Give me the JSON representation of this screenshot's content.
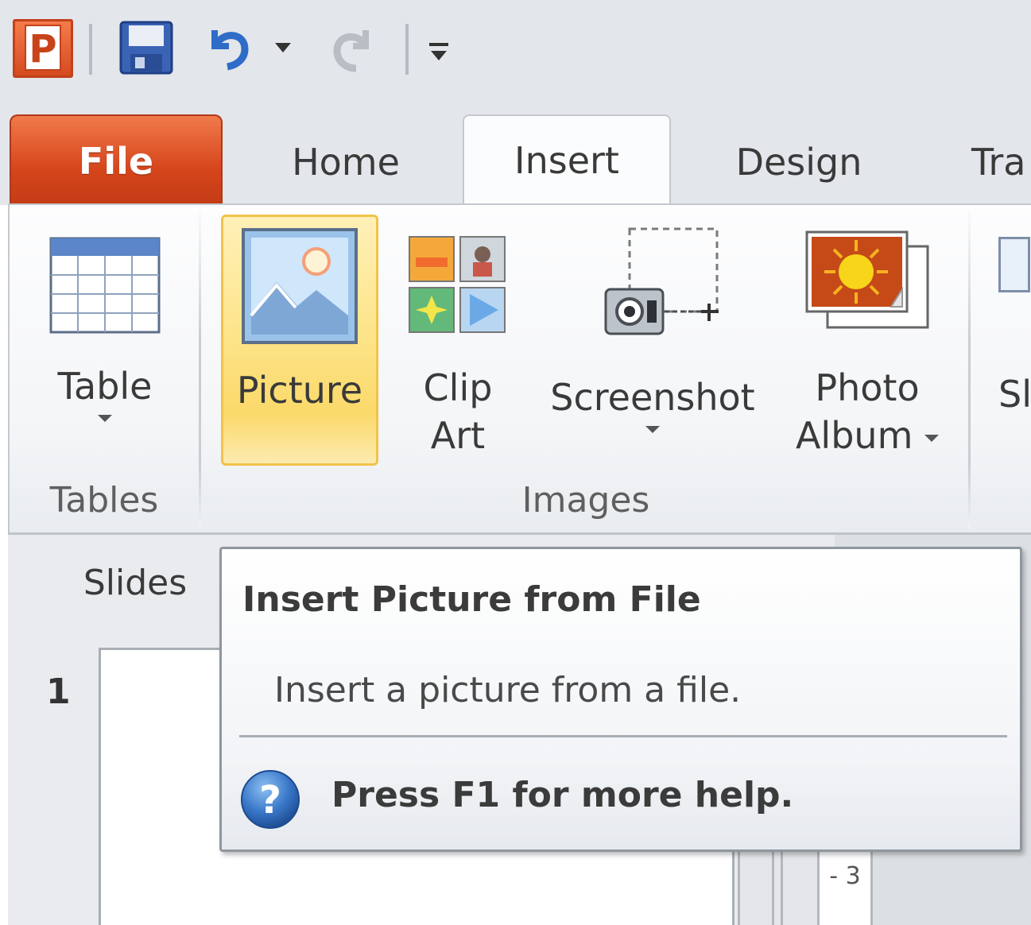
{
  "quick_access": {
    "app_letter": "P",
    "icons": [
      "powerpoint-logo-icon",
      "save-icon",
      "undo-icon",
      "undo-dropdown-icon",
      "redo-icon",
      "customize-toolbar-icon"
    ]
  },
  "tabs": [
    {
      "label": "File"
    },
    {
      "label": "Home"
    },
    {
      "label": "Insert"
    },
    {
      "label": "Design"
    },
    {
      "label": "Tra"
    }
  ],
  "ribbon": {
    "groups": {
      "tables": {
        "label": "Tables"
      },
      "images": {
        "label": "Images"
      }
    },
    "buttons": {
      "table": {
        "label": "Table"
      },
      "picture": {
        "label": "Picture"
      },
      "clip_art": {
        "line1": "Clip",
        "line2": "Art"
      },
      "screenshot": {
        "label": "Screenshot"
      },
      "photo_album": {
        "line1": "Photo",
        "line2": "Album"
      },
      "next_partial": {
        "label": "Sl"
      }
    }
  },
  "slides_panel": {
    "tab_label": "Slides",
    "slide_number": "1",
    "ruler_marks": "- 3"
  },
  "tooltip": {
    "title": "Insert Picture from File",
    "description": "Insert a picture from a file.",
    "help_text": "Press F1 for more help."
  },
  "colors": {
    "file_tab": "#d6451b",
    "picture_highlight": "#fde58c",
    "ribbon_bg": "#f3f5f7"
  }
}
